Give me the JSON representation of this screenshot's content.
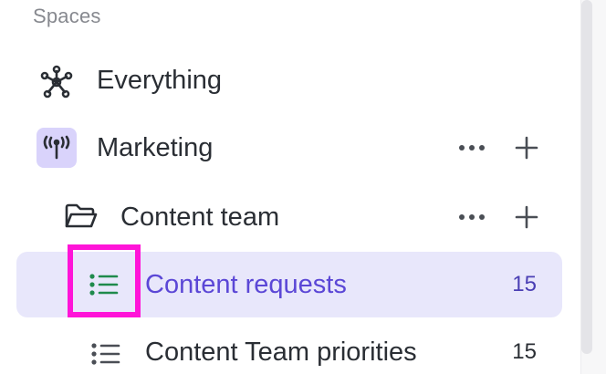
{
  "sidebar": {
    "section_title": "Spaces",
    "items": [
      {
        "label": "Everything",
        "icon": "hub-icon"
      },
      {
        "label": "Marketing",
        "icon": "broadcast-icon",
        "badge_color": "#d9d3fb"
      },
      {
        "label": "Content team",
        "icon": "folder-icon"
      },
      {
        "label": "Content requests",
        "icon": "list-icon",
        "count": "15",
        "active": true,
        "icon_color": "#1f8a4c"
      },
      {
        "label": "Content Team priorities",
        "icon": "list-icon",
        "count": "15"
      }
    ]
  },
  "colors": {
    "accent": "#5b47d6",
    "active_bg": "#e8e7fb",
    "highlight": "#ff14d8"
  }
}
